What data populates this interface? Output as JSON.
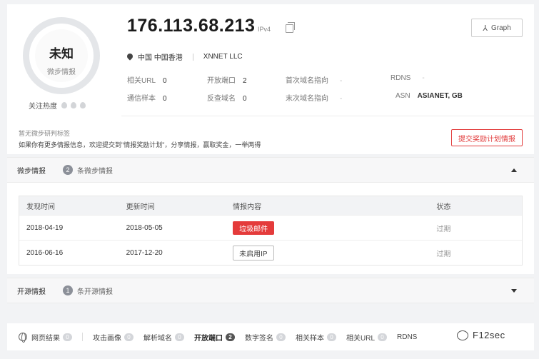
{
  "profile": {
    "verdict": "未知",
    "verdict_sub": "微步情报",
    "heat_label": "关注热度"
  },
  "header": {
    "ip": "176.113.68.213",
    "ip_version": "IPv4",
    "graph_label": "Graph",
    "location": "中国 中国香港",
    "org": "XNNET LLC"
  },
  "stats": {
    "related_url_label": "相关URL",
    "related_url": "0",
    "open_ports_label": "开放端口",
    "open_ports": "2",
    "first_domain_label": "首次域名指向",
    "first_domain": "-",
    "rdns_label": "RDNS",
    "rdns": "-",
    "comm_samples_label": "通信样本",
    "comm_samples": "0",
    "reverse_domain_label": "反查域名",
    "reverse_domain": "0",
    "last_domain_label": "末次域名指向",
    "last_domain": "-",
    "asn_label": "ASN",
    "asn": "ASIANET, GB"
  },
  "tags": {
    "none_text": "暂无微步研判标签",
    "more_info_text": "如果你有更多情报信息，欢迎提交到\"情报奖励计划\"，分享情报，赢取奖金，一举两得",
    "reward_button": "提交奖励计划情报"
  },
  "micro_section": {
    "title": "微步情报",
    "count": "2",
    "count_label": "条微步情报",
    "columns": [
      "发现时间",
      "更新时间",
      "情报内容",
      "状态"
    ],
    "rows": [
      {
        "found": "2018-04-19",
        "updated": "2018-05-05",
        "content": "垃圾邮件",
        "status": "过期"
      },
      {
        "found": "2016-06-16",
        "updated": "2017-12-20",
        "content": "未启用IP",
        "status": "过期"
      }
    ]
  },
  "open_section": {
    "title": "开源情报",
    "count": "1",
    "count_label": "条开源情报"
  },
  "tabs": [
    {
      "label": "网页结果",
      "count": "0"
    },
    {
      "label": "攻击画像",
      "count": "0"
    },
    {
      "label": "解析域名",
      "count": "0"
    },
    {
      "label": "开放端口",
      "count": "2"
    },
    {
      "label": "数字签名",
      "count": "0"
    },
    {
      "label": "相关样本",
      "count": "0"
    },
    {
      "label": "相关URL",
      "count": "0"
    },
    {
      "label": "RDNS",
      "count": ""
    }
  ],
  "watermark": "F12sec",
  "colors": {
    "accent_red": "#e43b3b",
    "badge_gray": "#8c9099"
  }
}
